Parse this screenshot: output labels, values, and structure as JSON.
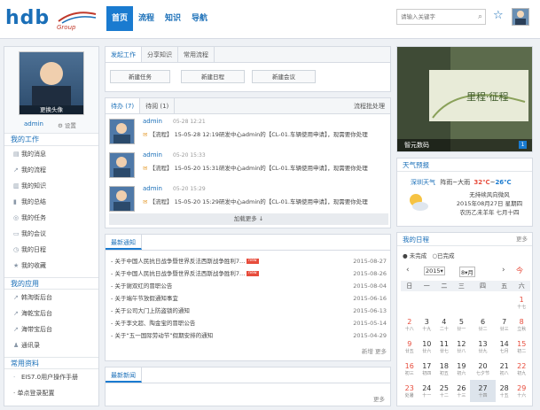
{
  "header": {
    "logo_text": "hdb",
    "logo_sub": "Group",
    "nav": [
      {
        "label": "首页",
        "active": true
      },
      {
        "label": "流程",
        "active": false
      },
      {
        "label": "知识",
        "active": false
      },
      {
        "label": "导航",
        "active": false
      }
    ],
    "search_placeholder": "请输入关键字"
  },
  "profile": {
    "change_avatar": "更换头像",
    "name": "admin",
    "settings": "设置"
  },
  "sidebar": {
    "work_title": "我的工作",
    "work_items": [
      "我的消息",
      "我的流程",
      "我的知识",
      "我的总结",
      "我的任务",
      "我的会议",
      "我的日程",
      "我的收藏"
    ],
    "apps_title": "我的应用",
    "app_items": [
      "韩淘街后台",
      "海乾宝后台",
      "海带宝后台",
      "通讯录"
    ],
    "docs_title": "常用资料",
    "doc_items": [
      "EIS7.0用户操作手册",
      "· 单点登录配置"
    ]
  },
  "launch": {
    "tabs": [
      "发起工作",
      "分享知识",
      "常用流程"
    ],
    "buttons": [
      "新建任务",
      "新建日程",
      "新建会议"
    ]
  },
  "todo": {
    "tabs": [
      "待办 (7)",
      "待阅 (1)"
    ],
    "action": "流程批处理",
    "items": [
      {
        "name": "admin",
        "time": "05-28 12:21",
        "text": "【流程】 15-05-28 12:19研发中心admin的【CL-01.车辆使用申请】，现需要你处理"
      },
      {
        "name": "admin",
        "time": "05-20 15:33",
        "text": "【流程】 15-05-20 15:31研发中心admin的【CL-01.车辆使用申请】，现需要你处理"
      },
      {
        "name": "admin",
        "time": "05-20 15:29",
        "text": "【流程】 15-05-20 15:29研发中心admin的【CL-01.车辆使用申请】，现需要你处理"
      }
    ],
    "load_more": "加载更多 ↓"
  },
  "notice": {
    "title": "最新通知",
    "items": [
      {
        "text": "关于中国人民抗日战争暨世界反法西斯战争胜利7...",
        "date": "2015-08-27",
        "is_new": true
      },
      {
        "text": "关于中国人民抗日战争暨世界反法西斯战争胜利7...",
        "date": "2015-08-26",
        "is_new": true
      },
      {
        "text": "关于谢双红的冒职公告",
        "date": "2015-08-04",
        "is_new": false
      },
      {
        "text": "关于端午节放假通知事宜",
        "date": "2015-06-16",
        "is_new": false
      },
      {
        "text": "关于公司大门上防盗锁的通知",
        "date": "2015-06-13",
        "is_new": false
      },
      {
        "text": "关于李文超、陶金宝的冒职公告",
        "date": "2015-05-14",
        "is_new": false
      },
      {
        "text": "关于“五一国际劳动节”假期安排的通知",
        "date": "2015-04-29",
        "is_new": false
      }
    ],
    "footer": "新增 更多"
  },
  "news": {
    "title": "最新新闻",
    "more": "更多"
  },
  "banner": {
    "caption": "智元数码",
    "page": "1",
    "slogan": "里程·征程"
  },
  "weather": {
    "title": "天气预报",
    "city": "深圳天气",
    "forecast": "阵雨~大雨",
    "high": "32℃",
    "low": "26℃",
    "wind": "无持续风向微风",
    "date": "2015年08月27日 星期四",
    "lunar": "农历乙未羊年 七月十四"
  },
  "schedule": {
    "title": "我的日程",
    "more": "更多",
    "status_undone": "未完成",
    "status_done": "已完成",
    "year": "2015",
    "month": "8",
    "today_btn": "今",
    "weekdays": [
      "日",
      "一",
      "二",
      "三",
      "四",
      "五",
      "六"
    ],
    "weeks": [
      [
        [
          "",
          ""
        ],
        [
          "",
          ""
        ],
        [
          "",
          ""
        ],
        [
          "",
          ""
        ],
        [
          "",
          ""
        ],
        [
          "",
          ""
        ],
        [
          "1",
          "十七"
        ]
      ],
      [
        [
          "2",
          "十八"
        ],
        [
          "3",
          "十九"
        ],
        [
          "4",
          "二十"
        ],
        [
          "5",
          "廿一"
        ],
        [
          "6",
          "廿二"
        ],
        [
          "7",
          "廿三"
        ],
        [
          "8",
          "立秋"
        ]
      ],
      [
        [
          "9",
          "廿五"
        ],
        [
          "10",
          "廿六"
        ],
        [
          "11",
          "廿七"
        ],
        [
          "12",
          "廿八"
        ],
        [
          "13",
          "廿九"
        ],
        [
          "14",
          "七月"
        ],
        [
          "15",
          "初二"
        ]
      ],
      [
        [
          "16",
          "初三"
        ],
        [
          "17",
          "初四"
        ],
        [
          "18",
          "初五"
        ],
        [
          "19",
          "初六"
        ],
        [
          "20",
          "七夕节"
        ],
        [
          "21",
          "初八"
        ],
        [
          "22",
          "初九"
        ]
      ],
      [
        [
          "23",
          "处暑"
        ],
        [
          "24",
          "十一"
        ],
        [
          "25",
          "十二"
        ],
        [
          "26",
          "十三"
        ],
        [
          "27",
          "十四"
        ],
        [
          "28",
          "十五"
        ],
        [
          "29",
          "十六"
        ]
      ]
    ]
  },
  "colors": {
    "brand": "#1a7bd0",
    "accent_red": "#e74c3c",
    "temp_high": "#e74c3c",
    "temp_low": "#1a7bd0"
  }
}
